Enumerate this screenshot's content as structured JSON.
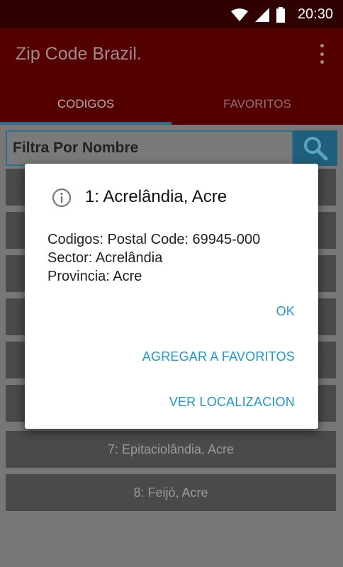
{
  "status_bar": {
    "time": "20:30",
    "icons": [
      "wifi-icon",
      "signal-icon",
      "battery-icon"
    ]
  },
  "app_bar": {
    "title": "Zip Code Brazil.",
    "overflow_icon": "more-vert-icon"
  },
  "tabs": [
    {
      "label": "CODIGOS",
      "selected": true
    },
    {
      "label": "FAVORITOS",
      "selected": false
    }
  ],
  "search": {
    "placeholder": "Filtra Por Nombre",
    "icon": "search-icon"
  },
  "list": {
    "items": [
      {
        "label": ""
      },
      {
        "label": ""
      },
      {
        "label": ""
      },
      {
        "label": ""
      },
      {
        "label": ""
      },
      {
        "label": ""
      },
      {
        "label": "7: Epitaciolândia, Acre"
      },
      {
        "label": "8: Feijó, Acre"
      }
    ]
  },
  "dialog": {
    "icon": "info-icon",
    "title": "1: Acrelândia, Acre",
    "lines": [
      "Codigos: Postal Code: 69945-000",
      "Sector: Acrelândia",
      "Provincia: Acre"
    ],
    "buttons": {
      "ok": "OK",
      "favorites": "AGREGAR A FAVORITOS",
      "location": "VER LOCALIZACION"
    }
  },
  "colors": {
    "app_bar": "#550000",
    "status_bar": "#300000",
    "accent": "#1a9ad6",
    "tab_indicator": "#2a6f8d"
  }
}
